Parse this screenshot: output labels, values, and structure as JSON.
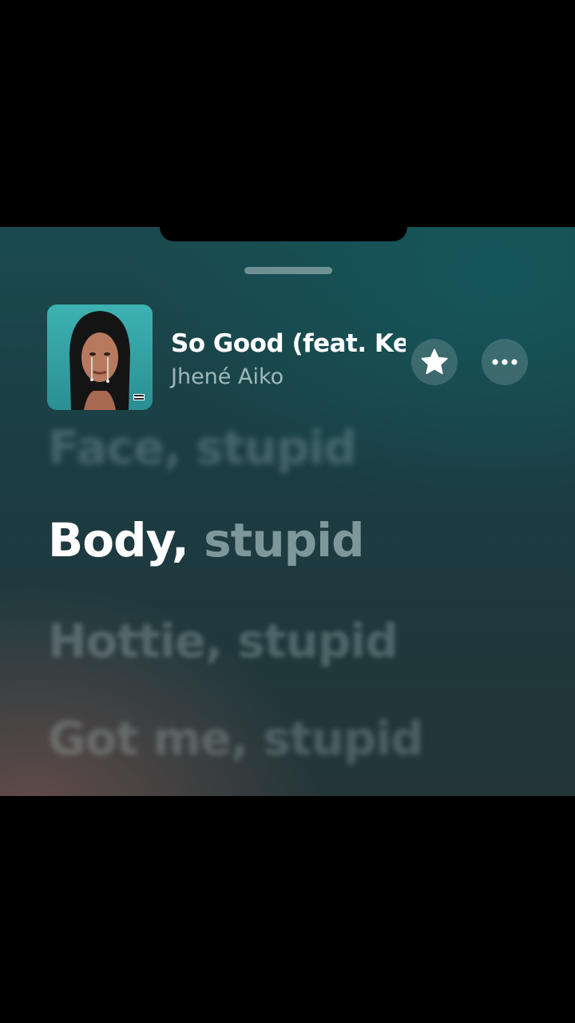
{
  "now_playing": {
    "title": "So Good (feat. Kehlani)",
    "artist": "Jhené Aiko",
    "artwork_icon": "album-artwork",
    "favorite_icon": "star-icon",
    "more_icon": "ellipsis-icon"
  },
  "lyrics": {
    "previous": "Face, stupid",
    "current_sung": "Body,",
    "current_unsung": " stupid",
    "next": [
      "Hottie, stupid",
      "Got me, stupid"
    ]
  },
  "colors": {
    "background_teal": "#1b3c42",
    "highlight": "#ffffff"
  }
}
